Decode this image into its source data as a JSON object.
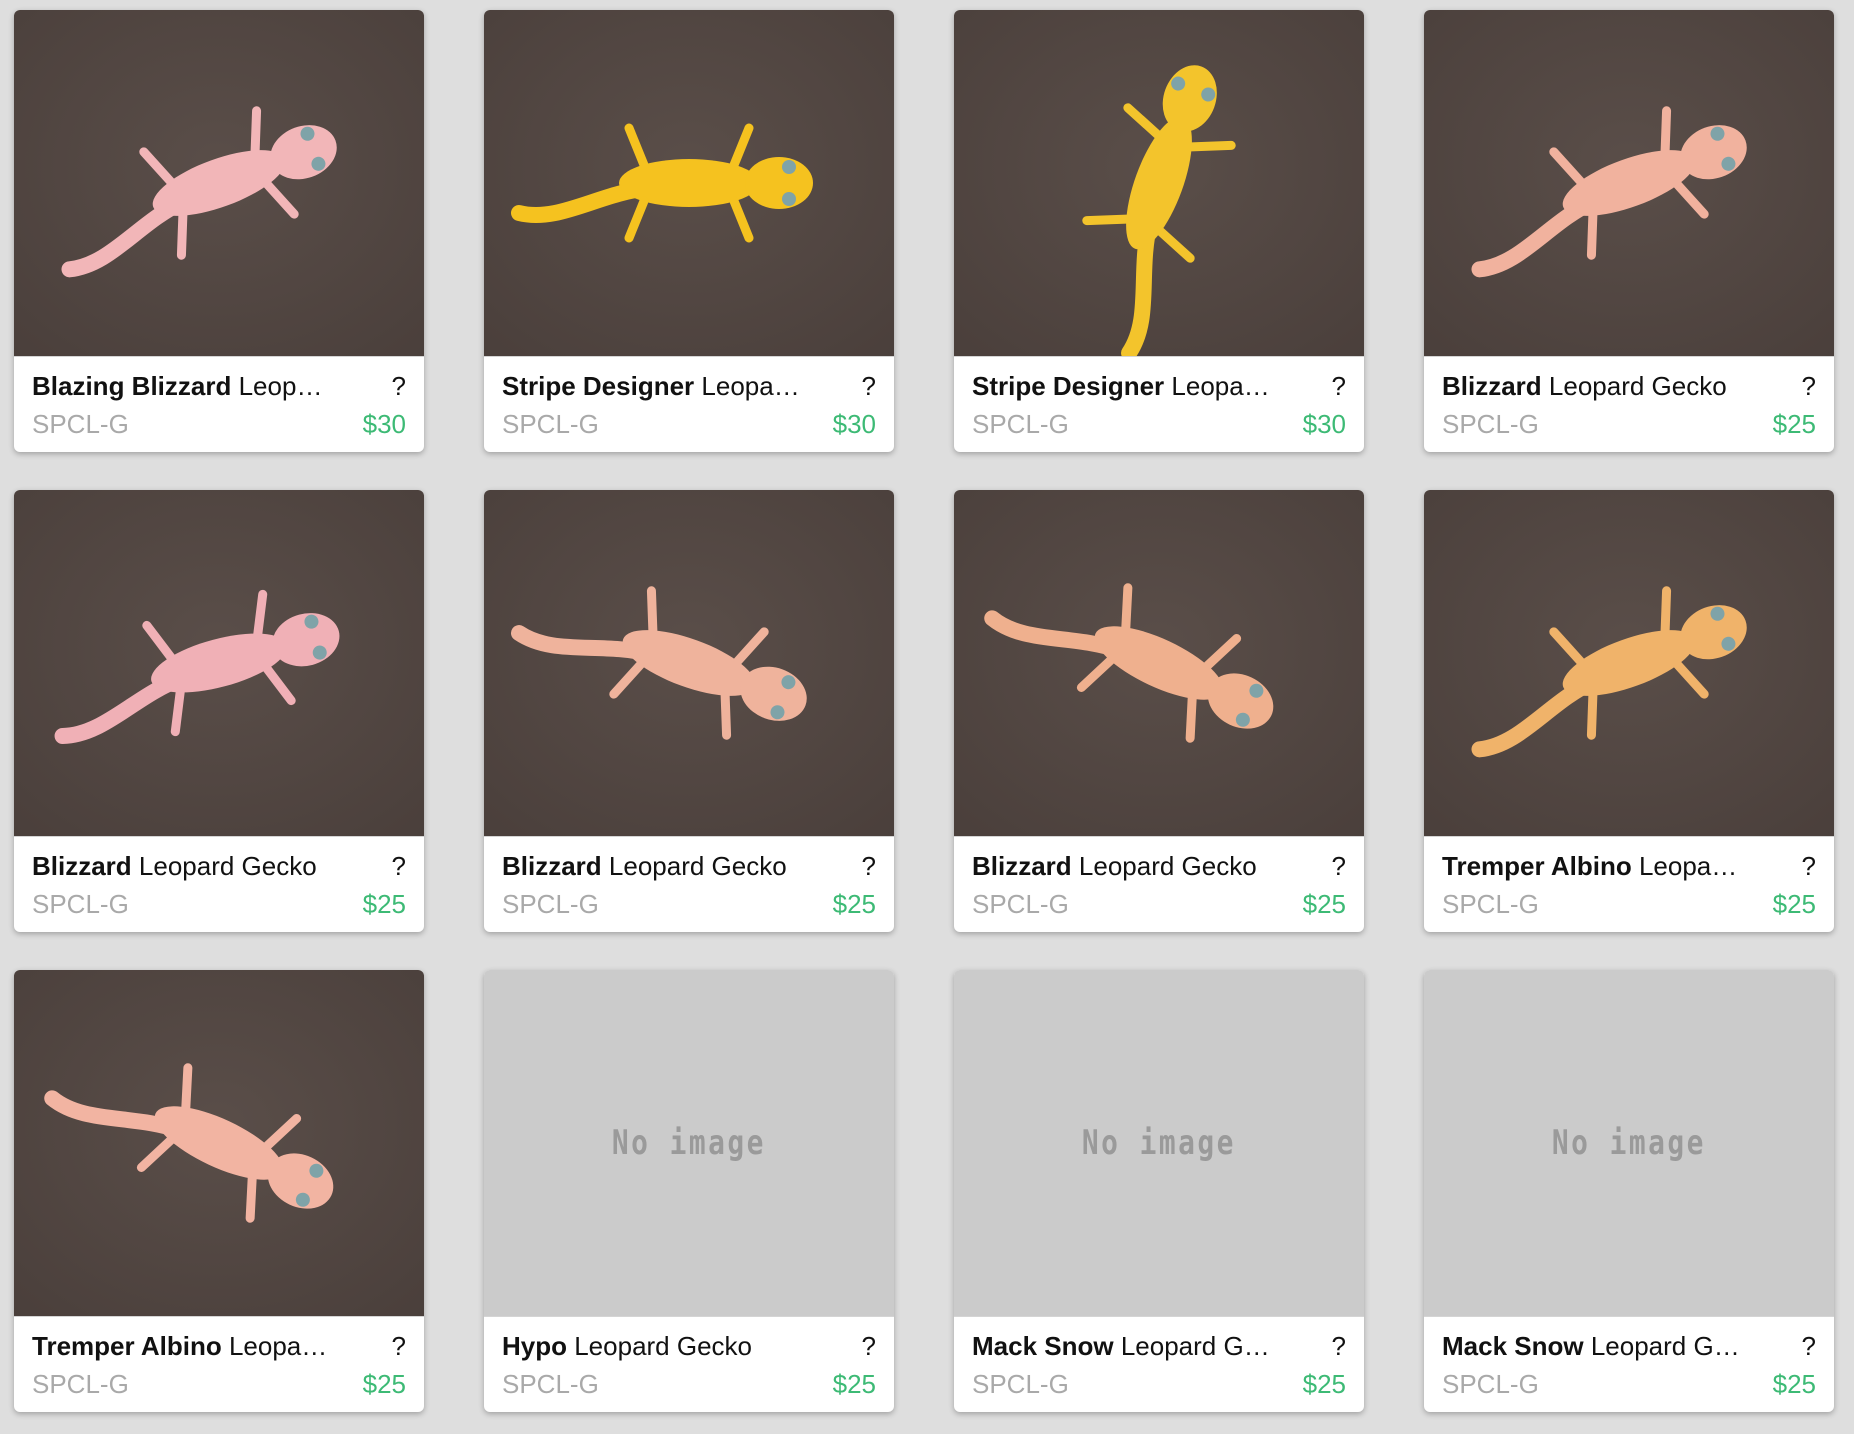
{
  "colors": {
    "background": "#dedede",
    "price": "#3dba75",
    "code": "#a9a9a9",
    "no_image_bg": "#cbcbcb",
    "photo_backdrop": "#4a3f3b"
  },
  "products": [
    {
      "morph": "Blazing Blizzard",
      "rest": " Leopard Gecko",
      "help": "?",
      "code": "SPCL-G",
      "price": "$30",
      "image": "gecko-photo",
      "tint": "#f2b6b8"
    },
    {
      "morph": "Stripe Designer",
      "rest": " Leopard Gecko",
      "help": "?",
      "code": "SPCL-G",
      "price": "$30",
      "image": "gecko-photo",
      "tint": "#f5c21f"
    },
    {
      "morph": "Stripe Designer",
      "rest": " Leopard Gecko",
      "help": "?",
      "code": "SPCL-G",
      "price": "$30",
      "image": "gecko-photo",
      "tint": "#f3c42c"
    },
    {
      "morph": "Blizzard",
      "rest": " Leopard Gecko",
      "help": "?",
      "code": "SPCL-G",
      "price": "$25",
      "image": "gecko-photo",
      "tint": "#f1b29e"
    },
    {
      "morph": "Blizzard",
      "rest": " Leopard Gecko",
      "help": "?",
      "code": "SPCL-G",
      "price": "$25",
      "image": "gecko-photo",
      "tint": "#f0b0b6"
    },
    {
      "morph": "Blizzard",
      "rest": " Leopard Gecko",
      "help": "?",
      "code": "SPCL-G",
      "price": "$25",
      "image": "gecko-photo",
      "tint": "#efb39c"
    },
    {
      "morph": "Blizzard",
      "rest": " Leopard Gecko",
      "help": "?",
      "code": "SPCL-G",
      "price": "$25",
      "image": "gecko-photo",
      "tint": "#efb08e"
    },
    {
      "morph": "Tremper Albino",
      "rest": " Leopard Gecko",
      "help": "?",
      "code": "SPCL-G",
      "price": "$25",
      "image": "gecko-photo",
      "tint": "#f0b36a"
    },
    {
      "morph": "Tremper Albino",
      "rest": " Leopard Gecko",
      "help": "?",
      "code": "SPCL-G",
      "price": "$25",
      "image": "gecko-photo",
      "tint": "#f2b4a2"
    },
    {
      "morph": "Hypo",
      "rest": " Leopard Gecko",
      "help": "?",
      "code": "SPCL-G",
      "price": "$25",
      "image": "no-image",
      "no_image_text": "No image"
    },
    {
      "morph": "Mack Snow",
      "rest": " Leopard Gecko",
      "help": "?",
      "code": "SPCL-G",
      "price": "$25",
      "image": "no-image",
      "no_image_text": "No image"
    },
    {
      "morph": "Mack Snow",
      "rest": " Leopard Gecko",
      "help": "?",
      "code": "SPCL-G",
      "price": "$25",
      "image": "no-image",
      "no_image_text": "No image"
    }
  ]
}
